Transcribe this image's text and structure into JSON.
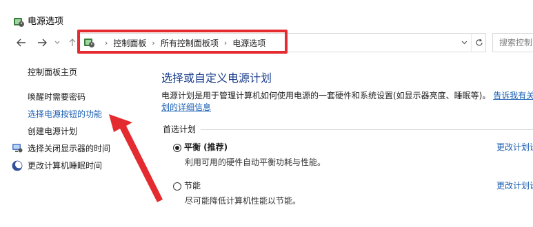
{
  "window": {
    "title": "电源选项"
  },
  "nav": {
    "back_icon": "back-arrow-icon",
    "forward_icon": "forward-arrow-icon",
    "recent_icon": "chevron-down-icon",
    "up_icon": "up-arrow-icon"
  },
  "address": {
    "breadcrumbs": [
      "控制面板",
      "所有控制面板项",
      "电源选项"
    ],
    "separator": "›",
    "search_placeholder": "搜索控制"
  },
  "sidebar": {
    "items": [
      {
        "label": "控制面板主页"
      },
      {
        "label": "唤醒时需要密码"
      },
      {
        "label": "选择电源按钮的功能"
      },
      {
        "label": "创建电源计划"
      },
      {
        "label": "选择关闭显示器的时间",
        "icon": "display-icon"
      },
      {
        "label": "更改计算机睡眠时间",
        "icon": "moon-icon"
      }
    ]
  },
  "main": {
    "heading": "选择或自定义电源计划",
    "description_text": "电源计划是用于管理计算机如何使用电源的一套硬件和系统设置(如显示器亮度、睡眠等)。",
    "description_link_part1": "告诉我有关",
    "description_link_part2": "划的详细信息",
    "section_label": "首选计划",
    "plans": [
      {
        "name": "平衡 (推荐)",
        "description": "利用可用的硬件自动平衡功耗与性能。",
        "selected": true,
        "change_label": "更改计划设"
      },
      {
        "name": "节能",
        "description": "尽可能降低计算机性能以节能。",
        "selected": false,
        "change_label": "更改计划设"
      }
    ]
  },
  "colors": {
    "link": "#1a5fb4",
    "heading": "#1a3e8c",
    "highlight": "#e42b2f"
  }
}
